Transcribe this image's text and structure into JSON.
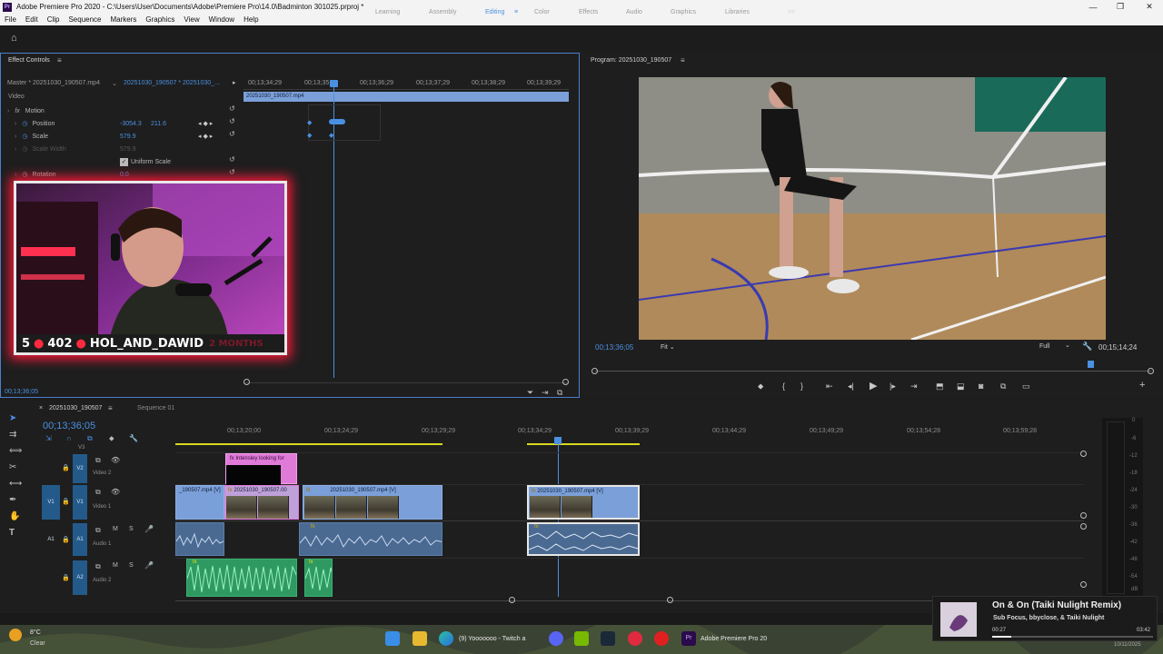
{
  "app": {
    "title": "Adobe Premiere Pro 2020 - C:\\Users\\User\\Documents\\Adobe\\Premiere Pro\\14.0\\Badminton 301025.prproj *"
  },
  "menu": [
    "File",
    "Edit",
    "Clip",
    "Sequence",
    "Markers",
    "Graphics",
    "View",
    "Window",
    "Help"
  ],
  "workspaces": {
    "tabs": [
      "Learning",
      "Assembly",
      "Editing",
      "Color",
      "Effects",
      "Audio",
      "Graphics",
      "Libraries"
    ],
    "active": "Editing",
    "more_icon": ">>"
  },
  "effect_controls": {
    "panel_title": "Effect Controls",
    "master_label": "Master * 20251030_190507.mp4",
    "sequence_clip": "20251030_190507 * 20251030_...",
    "section": "Video",
    "motion_label": "Motion",
    "position_label": "Position",
    "position_x": "-3054.3",
    "position_y": "211.6",
    "scale_label": "Scale",
    "scale_value": "579.9",
    "scale_width_label": "Scale Width",
    "scale_width_value": "579.9",
    "uniform_scale_label": "Uniform Scale",
    "rotation_label": "Rotation",
    "rotation_value": "0.0",
    "timecodes": [
      "00;13;34;29",
      "00;13;35;29",
      "00;13;36;29",
      "00;13;37;29",
      "00;13;38;29",
      "00;13;39;29"
    ],
    "clip_name": "20251030_190507.mp4",
    "current_time": "00;13;36;05"
  },
  "webcam": {
    "streak": "5",
    "count": "402",
    "handle": "HOL_AND_DAWID",
    "faded_text": "2 MONTHS"
  },
  "program": {
    "title": "Program: 20251030_190507",
    "timecode": "00;13;36;05",
    "fit": "Fit",
    "quality": "Full",
    "duration": "00;15;14;24"
  },
  "timeline": {
    "tab_sequence": "20251030_190507",
    "tab_other": "Sequence 01",
    "timecode": "00;13;36;05",
    "ruler": [
      "00;13;20;00",
      "00;13;24;29",
      "00;13;29;29",
      "00;13;34;29",
      "00;13;39;29",
      "00;13;44;29",
      "00;13;49;29",
      "00;13;54;28",
      "00;13;59;28"
    ],
    "tracks": [
      {
        "id": "V3",
        "name": ""
      },
      {
        "id": "V2",
        "name": "Video 2"
      },
      {
        "id": "V1",
        "name": "Video 1"
      },
      {
        "id": "A1",
        "name": "Audio 1"
      },
      {
        "id": "A2",
        "name": "Audio 2"
      }
    ],
    "clips": {
      "v2_title": "Intensley looking for",
      "v1_a": "_190507.mp4 [V]",
      "v1_b": "20251030_190507.00",
      "v1_c": "20251030_190507.mp4 [V]",
      "v1_d": "20251030_190507.mp4 [V]"
    },
    "meter_labels": [
      "0",
      "-6",
      "-12",
      "-18",
      "-24",
      "-30",
      "-36",
      "-42",
      "-48",
      "-54",
      "dB"
    ]
  },
  "taskbar": {
    "weather_temp": "8°C",
    "weather_desc": "Clear",
    "twitch_label": "(9) Yooooooo - Twitch a",
    "premiere_label": "Adobe Premiere Pro 20",
    "date": "10/11/2025"
  },
  "notification": {
    "song": "On & On (Taiki Nulight Remix)",
    "artist": "Sub Focus, bbyclose, & Taiki Nulight",
    "elapsed": "00:27",
    "duration": "03:42",
    "progress": 0.12
  },
  "colors": {
    "accent": "#4a90e2",
    "video_clip": "#7b9fd8",
    "audio_clip": "#4a6a92",
    "audio2_clip": "#2e9a62",
    "title_clip": "#e07ad8",
    "glow": "#ff1a3a"
  }
}
